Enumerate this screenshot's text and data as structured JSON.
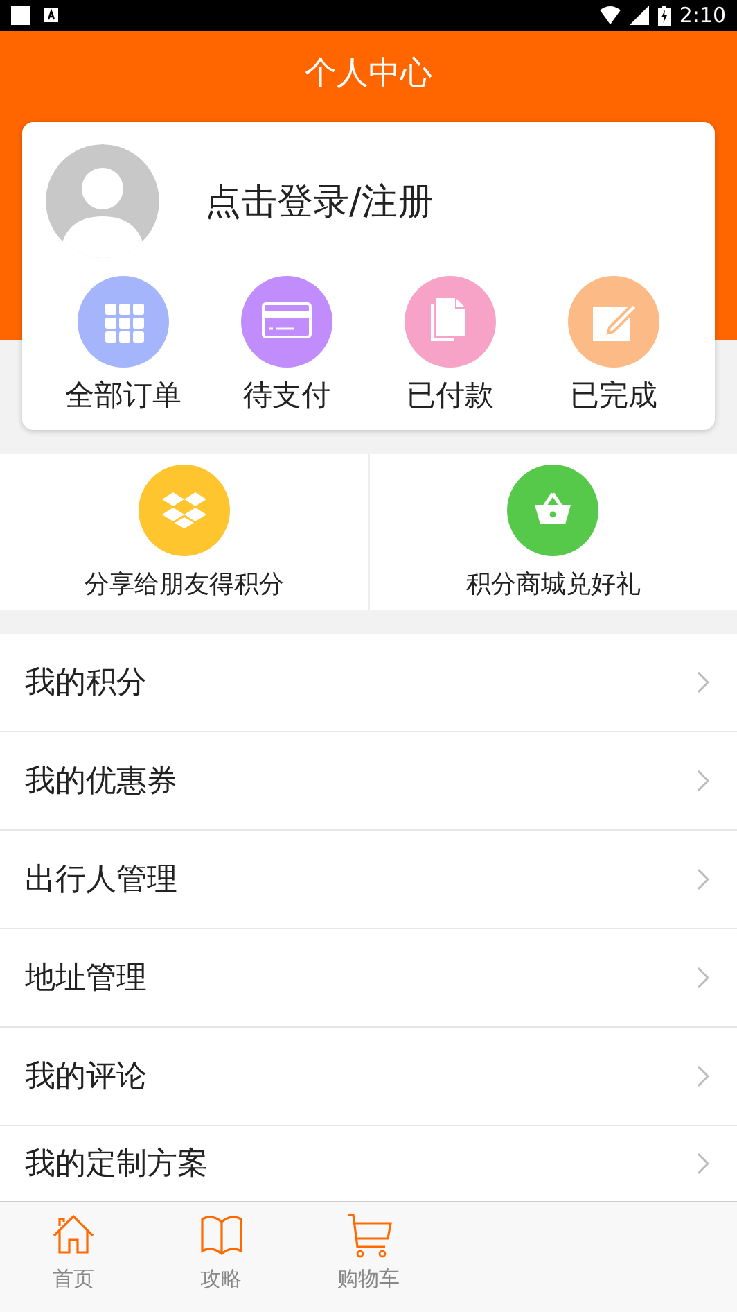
{
  "status_bar": {
    "time": "2:10"
  },
  "header": {
    "title": "个人中心"
  },
  "profile": {
    "login_text": "点击登录/注册"
  },
  "orders": [
    {
      "kind": "grid",
      "label": "全部订单",
      "color": "#a4b5fc"
    },
    {
      "kind": "card",
      "label": "待支付",
      "color": "#c18cfc"
    },
    {
      "kind": "document",
      "label": "已付款",
      "color": "#f7a3c8"
    },
    {
      "kind": "edit",
      "label": "已完成",
      "color": "#fcbb86"
    }
  ],
  "points": [
    {
      "kind": "box",
      "label": "分享给朋友得积分",
      "color": "#ffc52e"
    },
    {
      "kind": "basket",
      "label": "积分商城兑好礼",
      "color": "#57c94a"
    }
  ],
  "menu": [
    "我的积分",
    "我的优惠券",
    "出行人管理",
    "地址管理",
    "我的评论",
    "我的定制方案"
  ],
  "tabs": [
    {
      "kind": "home",
      "label": "首页"
    },
    {
      "kind": "book",
      "label": "攻略"
    },
    {
      "kind": "cart",
      "label": "购物车"
    }
  ]
}
